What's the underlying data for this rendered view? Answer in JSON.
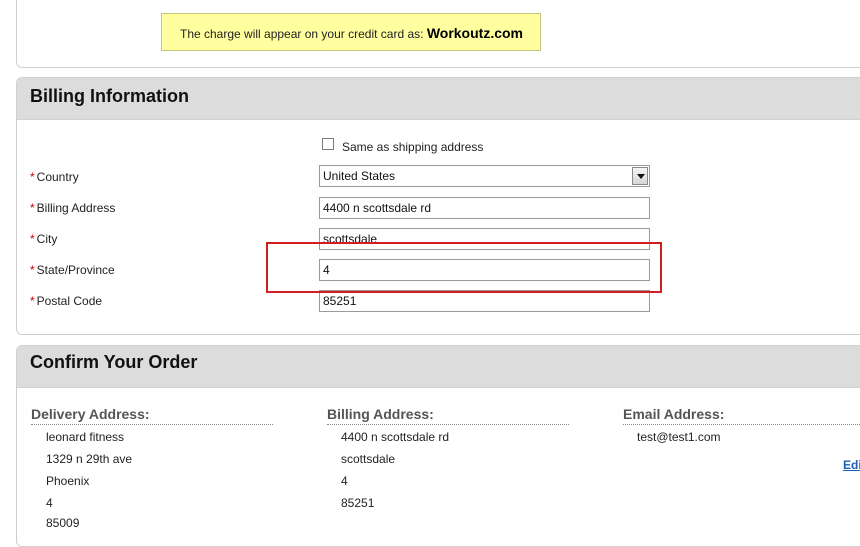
{
  "charge_note": {
    "prefix": "The charge will appear on your credit card as:",
    "brand": "Workoutz.com"
  },
  "billing": {
    "title": "Billing Information",
    "same_as_shipping_label": "Same as shipping address",
    "required_marker": "*",
    "fields": {
      "country": {
        "label": "Country",
        "value": "United States"
      },
      "address": {
        "label": "Billing Address",
        "value": "4400 n scottsdale rd"
      },
      "city": {
        "label": "City",
        "value": "scottsdale"
      },
      "state": {
        "label": "State/Province",
        "value": "4"
      },
      "postal": {
        "label": "Postal Code",
        "value": "85251"
      }
    }
  },
  "confirm": {
    "title": "Confirm Your Order",
    "delivery": {
      "heading": "Delivery Address:",
      "lines": [
        "leonard fitness",
        "1329 n 29th ave",
        "Phoenix",
        "4",
        "85009"
      ]
    },
    "billing_addr": {
      "heading": "Billing Address:",
      "lines": [
        "4400 n scottsdale rd",
        "scottsdale",
        "4",
        "85251"
      ]
    },
    "email": {
      "heading": "Email Address:",
      "value": "test@test1.com"
    },
    "edit_label": "Edi"
  },
  "colors": {
    "note_bg": "#ffffa0",
    "panel_header": "#dcdcdc",
    "highlight": "#d01f1f",
    "required": "#cc0000",
    "link": "#1a5fb4"
  }
}
